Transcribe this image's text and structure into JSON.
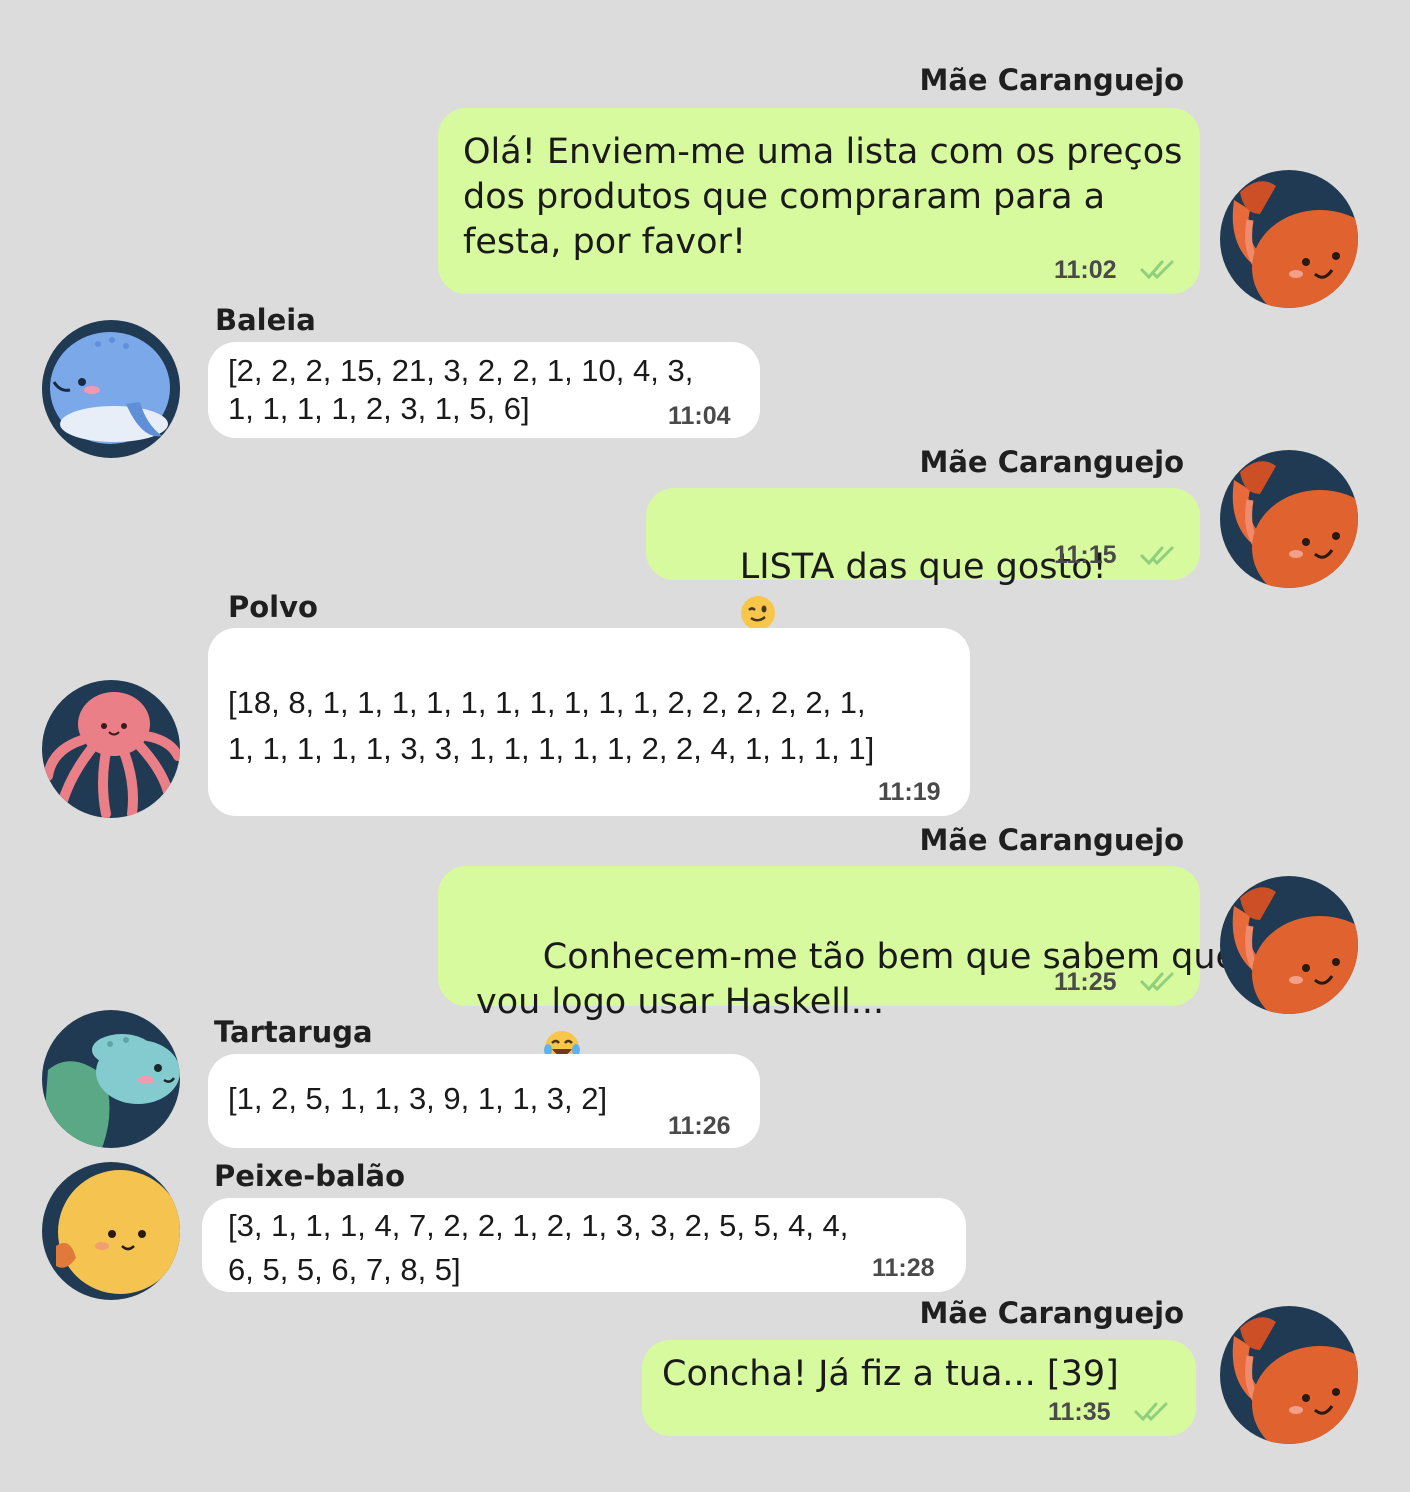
{
  "messages": [
    {
      "sender": "Mãe Caranguejo",
      "text": "Olá! Enviem-me uma lista com os preços\ndos produtos que compraram para a\nfesta, por favor!",
      "time": "11:02",
      "avatar": "crab-icon"
    },
    {
      "sender": "Baleia",
      "text": "[2, 2, 2, 15, 21, 3, 2, 2, 1, 10, 4, 3,\n1, 1, 1, 1, 2, 3, 1, 5, 6]",
      "time": "11:04",
      "avatar": "whale-icon"
    },
    {
      "sender": "Mãe Caranguejo",
      "text": "LISTA das que gosto!",
      "emoji": "winking-face-emoji",
      "time": "11:15",
      "avatar": "crab-icon"
    },
    {
      "sender": "Polvo",
      "text": "[18, 8, 1, 1, 1, 1, 1, 1, 1, 1, 1, 1, 2, 2, 2, 2, 2, 1,\n1, 1, 1, 1, 1, 3, 3, 1, 1, 1, 1, 1, 2, 2, 4, 1, 1, 1, 1]",
      "time": "11:19",
      "avatar": "octopus-icon"
    },
    {
      "sender": "Mãe Caranguejo",
      "text": "Conhecem-me tão bem que sabem que\nvou logo usar Haskell...",
      "emoji": "tears-of-joy-emoji",
      "time": "11:25",
      "avatar": "crab-icon"
    },
    {
      "sender": "Tartaruga",
      "text": "[1, 2, 5, 1, 1, 3, 9, 1, 1, 3, 2]",
      "time": "11:26",
      "avatar": "turtle-icon"
    },
    {
      "sender": "Peixe-balão",
      "text": "[3, 1, 1, 1, 4, 7, 2, 2, 1, 2, 1, 3, 3, 2, 5, 5, 4, 4,\n6, 5, 5, 6, 7, 8, 5]",
      "time": "11:28",
      "avatar": "pufferfish-icon"
    },
    {
      "sender": "Mãe Caranguejo",
      "text": "Concha! Já fiz a tua... [39]",
      "time": "11:35",
      "avatar": "crab-icon"
    }
  ],
  "colors": {
    "background": "#dcdcdc",
    "outgoing_bubble": "#d8fa9e",
    "incoming_bubble": "#ffffff",
    "avatar_bg": "#1f3a52",
    "read_ticks": "#8fcf7e"
  }
}
